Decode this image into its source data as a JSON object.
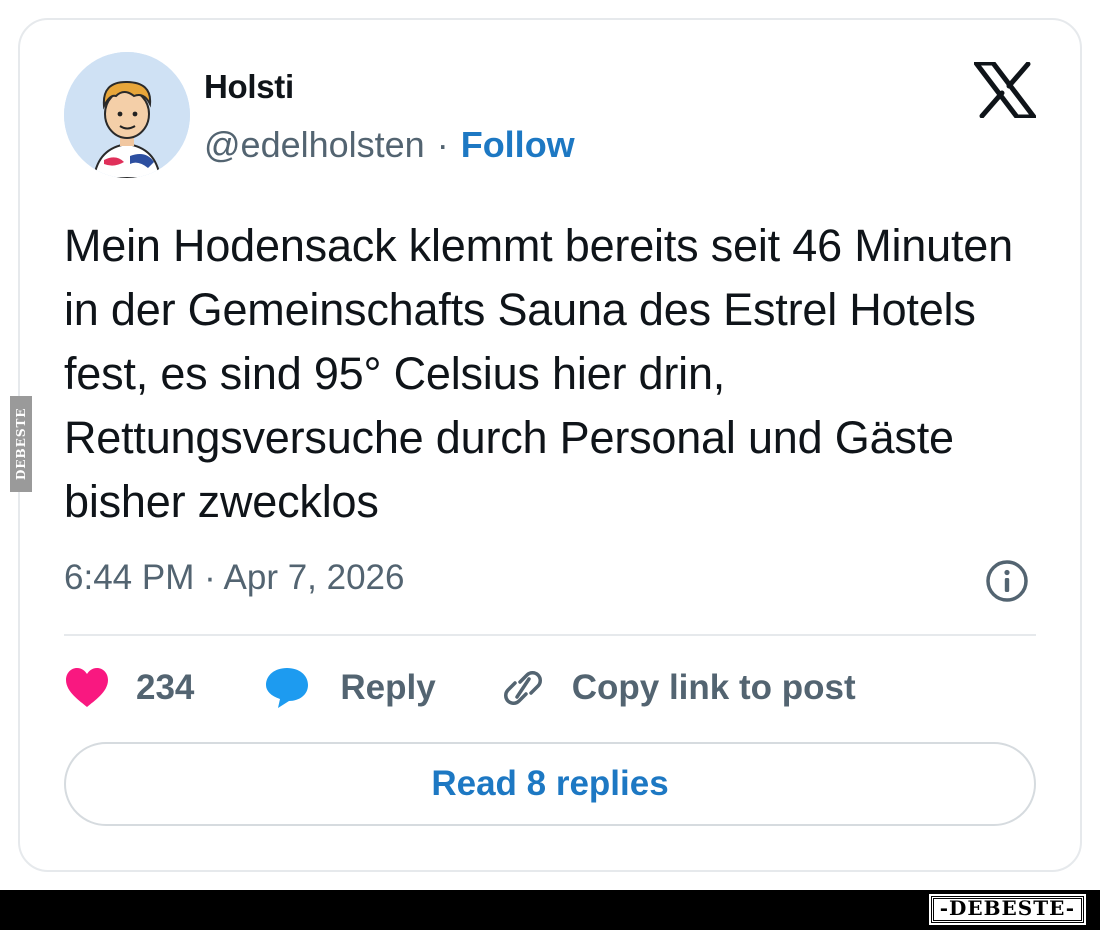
{
  "tweet": {
    "author_name": "Holsti",
    "handle": "@edelholsten",
    "separator": "·",
    "follow_label": "Follow",
    "platform_icon": "x-logo-icon",
    "text": "Mein Hodensack klemmt bereits seit 46 Minuten in der Gemeinschafts Sauna des Estrel Hotels fest, es sind 95° Celsius hier drin, Rettungsversuche durch Personal und Gäste bisher zwecklos",
    "timestamp": "6:44 PM · Apr 7, 2026",
    "info_icon": "info-icon"
  },
  "actions": {
    "like_count": "234",
    "like_icon": "heart-icon",
    "reply_label": "Reply",
    "reply_icon": "speech-bubble-icon",
    "copy_label": "Copy link to post",
    "copy_icon": "link-icon"
  },
  "read_replies_label": "Read 8 replies",
  "watermark": {
    "side_text": "DEBESTE",
    "footer_text": "-DEBESTE-"
  },
  "colors": {
    "accent": "#1d78c3",
    "heart": "#f91880",
    "reply_bubble": "#1d9bf0",
    "muted_text": "#536471",
    "border": "#e6e9ec"
  }
}
